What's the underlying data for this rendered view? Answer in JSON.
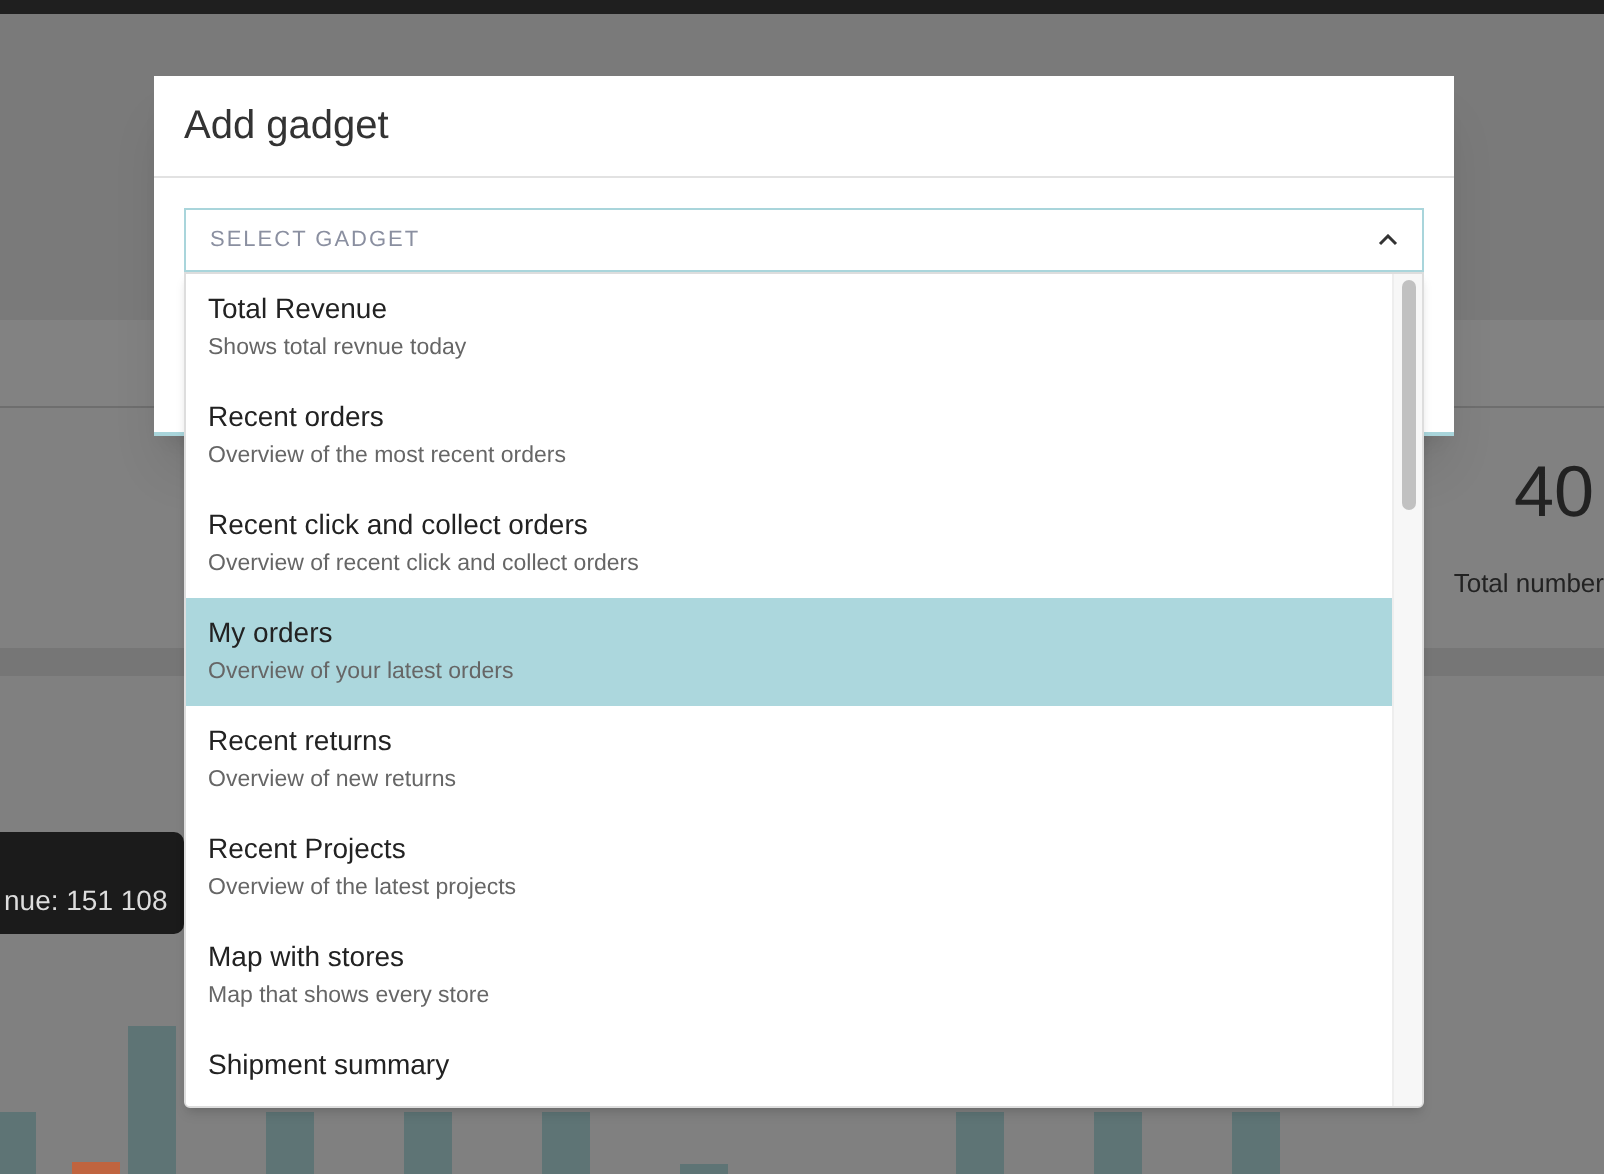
{
  "background": {
    "stat_value": "40",
    "stat_label": "Total number",
    "tooltip": "nue: 151 108"
  },
  "modal": {
    "title": "Add gadget",
    "select": {
      "placeholder": "SELECT GADGET",
      "expanded": true
    },
    "options": [
      {
        "title": "Total Revenue",
        "description": "Shows total revnue today",
        "selected": false
      },
      {
        "title": "Recent orders",
        "description": "Overview of the most recent orders",
        "selected": false
      },
      {
        "title": "Recent click and collect orders",
        "description": "Overview of recent click and collect orders",
        "selected": false
      },
      {
        "title": "My orders",
        "description": "Overview of your latest orders",
        "selected": true
      },
      {
        "title": "Recent returns",
        "description": "Overview of new returns",
        "selected": false
      },
      {
        "title": "Recent Projects",
        "description": "Overview of the latest projects",
        "selected": false
      },
      {
        "title": "Map with stores",
        "description": "Map that shows every store",
        "selected": false
      },
      {
        "title": "Shipment summary",
        "selected": false
      }
    ]
  }
}
